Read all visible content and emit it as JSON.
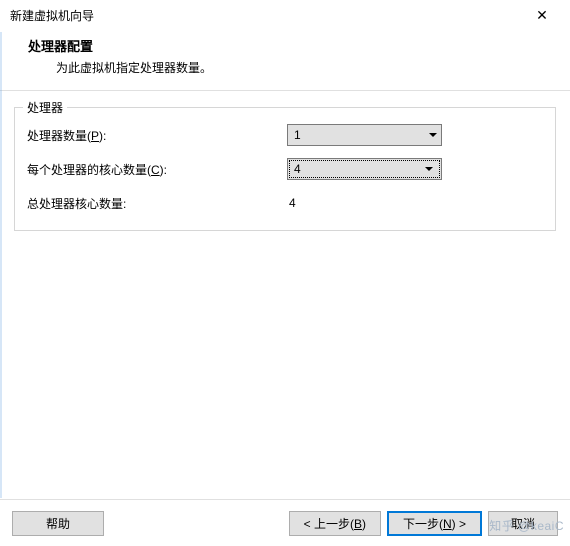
{
  "window": {
    "title": "新建虚拟机向导"
  },
  "header": {
    "main": "处理器配置",
    "sub": "为此虚拟机指定处理器数量。"
  },
  "group": {
    "legend": "处理器",
    "rows": {
      "proc_count": {
        "label_prefix": "处理器数量(",
        "mnemonic": "P",
        "label_suffix": "):",
        "value": "1"
      },
      "cores_per": {
        "label_prefix": "每个处理器的核心数量(",
        "mnemonic": "C",
        "label_suffix": "):",
        "value": "4"
      },
      "total_cores": {
        "label": "总处理器核心数量:",
        "value": "4"
      }
    }
  },
  "footer": {
    "help": "帮助",
    "back_prefix": "< 上一步(",
    "back_mnemonic": "B",
    "back_suffix": ")",
    "next_prefix": "下一步(",
    "next_mnemonic": "N",
    "next_suffix": ") >",
    "cancel": "取消"
  },
  "watermark": "知乎 @keaiC"
}
